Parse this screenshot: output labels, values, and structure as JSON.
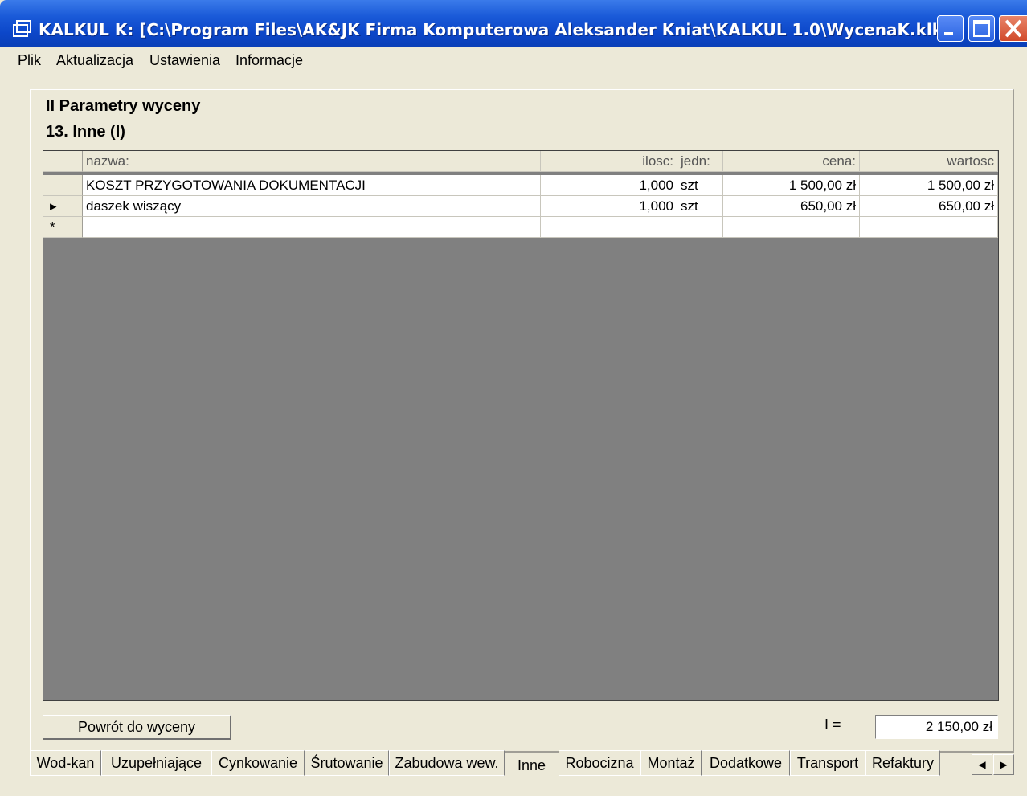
{
  "window": {
    "title": "KALKUL K: [C:\\Program Files\\AK&JK Firma Komputerowa Aleksander Kniat\\KALKUL 1.0\\WycenaK.klk]"
  },
  "menu": [
    "Plik",
    "Aktualizacja",
    "Ustawienia",
    "Informacje"
  ],
  "section": {
    "title": "II  Parametry wyceny",
    "subtitle": "13. Inne (I)"
  },
  "table": {
    "headers": {
      "nazwa": "nazwa:",
      "ilosc": "ilosc:",
      "jedn": "jedn:",
      "cena": "cena:",
      "wartosc": "wartosc"
    },
    "rows": [
      {
        "selector": "",
        "nazwa": "KOSZT PRZYGOTOWANIA DOKUMENTACJI",
        "ilosc": "1,000",
        "jedn": "szt",
        "cena": "1 500,00 zł",
        "wartosc": "1 500,00 zł"
      },
      {
        "selector": "▸",
        "nazwa": "daszek wiszący",
        "ilosc": "1,000",
        "jedn": "szt",
        "cena": "650,00 zł",
        "wartosc": "650,00 zł"
      },
      {
        "selector": "*",
        "nazwa": "",
        "ilosc": "",
        "jedn": "",
        "cena": "",
        "wartosc": ""
      }
    ]
  },
  "footer": {
    "back_button": "Powrót do wyceny",
    "sum_label": "I =",
    "sum_value": "2 150,00 zł"
  },
  "tabs": [
    "Wod-kan",
    "Uzupełniające",
    "Cynkowanie",
    "Śrutowanie",
    "Zabudowa wew.",
    "Inne",
    "Robocizna",
    "Montaż",
    "Dodatkowe",
    "Transport",
    "Refaktury"
  ],
  "active_tab": "Inne",
  "scroll": {
    "left": "◀",
    "right": "▶"
  }
}
